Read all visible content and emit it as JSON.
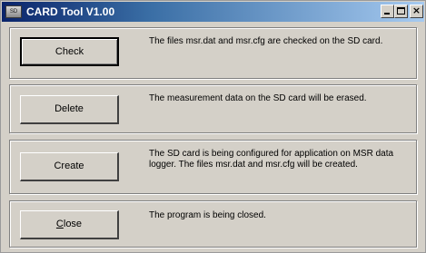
{
  "window": {
    "title": "CARD Tool V1.00",
    "icon_label": "SD",
    "controls": {
      "minimize": "minimize",
      "maximize": "maximize",
      "close": "×"
    }
  },
  "actions": [
    {
      "label": "Check",
      "description": "The files msr.dat and msr.cfg are checked on the SD card."
    },
    {
      "label": "Delete",
      "description": "The measurement data on the SD card will be erased."
    },
    {
      "label": "Create",
      "description": "The SD card is being configured for application on MSR data logger. The files msr.dat and msr.cfg will be created."
    },
    {
      "label_accel": "C",
      "label_rest": "lose",
      "description": "The program is being closed."
    }
  ],
  "colors": {
    "titlebar_start": "#0a246a",
    "titlebar_end": "#a6caf0",
    "face": "#d4d0c8"
  }
}
